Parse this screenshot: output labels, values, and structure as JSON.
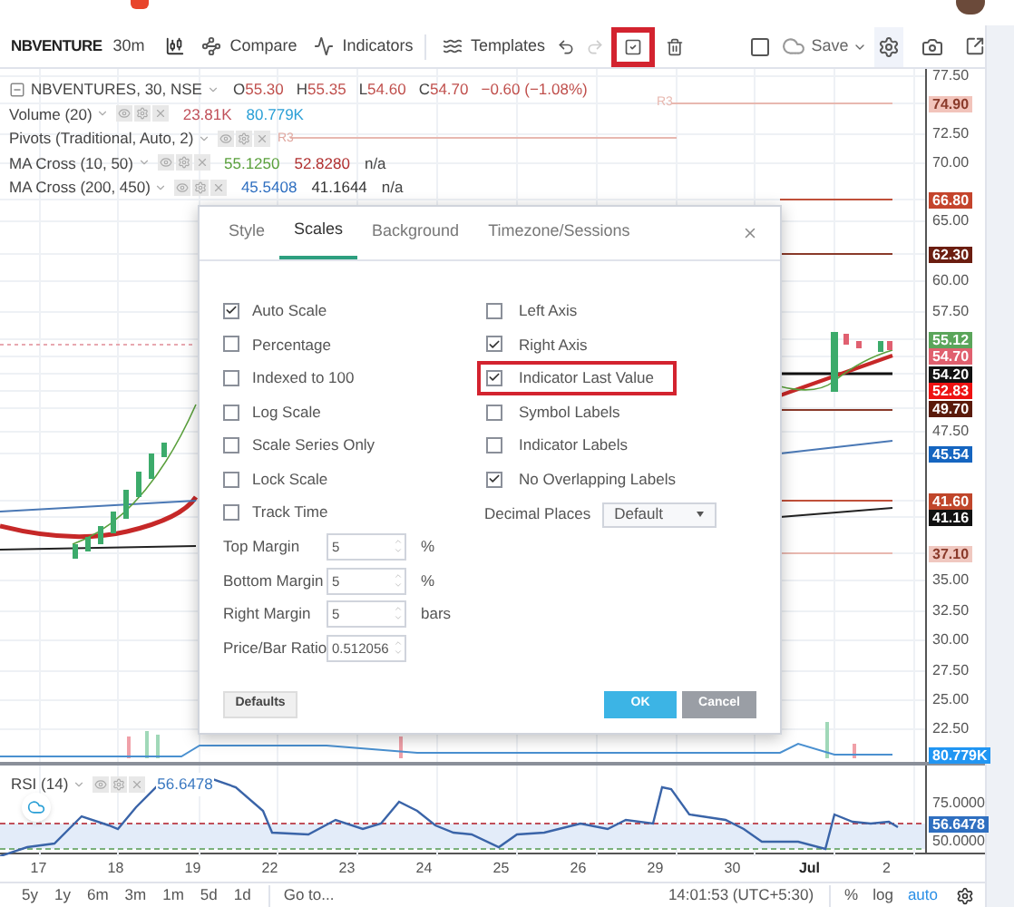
{
  "toolbar": {
    "symbol": "NBVENTURE",
    "interval": "30m",
    "buttons": [
      {
        "kind": "compare",
        "label": "Compare"
      },
      {
        "kind": "indicators",
        "label": "Indicators"
      },
      {
        "kind": "templates",
        "label": "Templates"
      }
    ],
    "tools": [
      {
        "kind": "undo",
        "disabled": false,
        "highlighted": false
      },
      {
        "kind": "redo",
        "disabled": true,
        "highlighted": false
      },
      {
        "kind": "check",
        "disabled": false,
        "highlighted": true
      },
      {
        "kind": "trash",
        "disabled": false,
        "highlighted": false
      }
    ],
    "save": "Save"
  },
  "legend": {
    "symbol": "NBVENTURES, 30, NSE",
    "ohlc": [
      {
        "label": "O",
        "value": "55.30"
      },
      {
        "label": "H",
        "value": "55.35"
      },
      {
        "label": "L",
        "value": "54.60"
      },
      {
        "label": "C",
        "value": "54.70"
      }
    ],
    "change": "−0.60 (−1.08%)",
    "indicators": [
      {
        "name": "Volume (20)",
        "values": [
          {
            "text": "23.81K",
            "color": "#c0505a"
          },
          {
            "text": "80.779K",
            "color": "#2a9fd6"
          }
        ]
      },
      {
        "name": "Pivots (Traditional, Auto, 2)"
      },
      {
        "name": "MA Cross (10, 50)",
        "values": [
          {
            "text": "55.1250",
            "color": "#5aa03c"
          },
          {
            "text": "52.8280",
            "color": "#b03030"
          },
          {
            "text": "n/a",
            "color": "#444444"
          }
        ]
      },
      {
        "name": "MA Cross (200, 450)",
        "values": [
          {
            "text": "45.5408",
            "color": "#2f6fc0"
          },
          {
            "text": "41.1644",
            "color": "#333333"
          },
          {
            "text": "n/a",
            "color": "#444444"
          }
        ]
      }
    ]
  },
  "chart_labels": [
    "R3",
    "R3"
  ],
  "price_axis": [
    {
      "kind": "tick",
      "text": "77.50"
    },
    {
      "kind": "badge",
      "text": "74.90",
      "color": "#f2c4bb"
    },
    {
      "kind": "tick",
      "text": "72.50"
    },
    {
      "kind": "tick",
      "text": "70.00"
    },
    {
      "kind": "badge",
      "text": "66.80",
      "color": "#c4442c"
    },
    {
      "kind": "tick",
      "text": "65.00"
    },
    {
      "kind": "badge",
      "text": "62.30",
      "color": "#6b1d10"
    },
    {
      "kind": "tick",
      "text": "60.00"
    },
    {
      "kind": "tick",
      "text": "57.50"
    },
    {
      "kind": "badge",
      "text": "55.12",
      "color": "#5aa55a"
    },
    {
      "kind": "badge",
      "text": "54.70",
      "color": "#e0606e"
    },
    {
      "kind": "badge",
      "text": "54.20",
      "color": "#111111"
    },
    {
      "kind": "badge",
      "text": "52.83",
      "color": "#ee1111"
    },
    {
      "kind": "badge",
      "text": "49.70",
      "color": "#5a1a0a"
    },
    {
      "kind": "tick",
      "text": "47.50"
    },
    {
      "kind": "badge",
      "text": "45.54",
      "color": "#1565c0"
    },
    {
      "kind": "badge",
      "text": "41.60",
      "color": "#c0462b"
    },
    {
      "kind": "badge",
      "text": "41.16",
      "color": "#111111"
    },
    {
      "kind": "badge",
      "text": "37.10",
      "color": "#f0c8c0"
    },
    {
      "kind": "tick",
      "text": "35.00"
    },
    {
      "kind": "tick",
      "text": "32.50"
    },
    {
      "kind": "tick",
      "text": "30.00"
    },
    {
      "kind": "tick",
      "text": "27.50"
    },
    {
      "kind": "tick",
      "text": "25.00"
    },
    {
      "kind": "tick",
      "text": "22.50"
    },
    {
      "kind": "badge",
      "text": "80.779K",
      "color": "#2196f3"
    }
  ],
  "rsi": {
    "name": "RSI (14)",
    "value": "56.6478",
    "axis": [
      {
        "kind": "tick",
        "text": "75.0000"
      },
      {
        "kind": "badge",
        "text": "56.6478",
        "color": "#2f6fc0"
      },
      {
        "kind": "tick",
        "text": "50.0000"
      }
    ]
  },
  "time_axis": [
    {
      "label": "17",
      "month_start": false
    },
    {
      "label": "18",
      "month_start": false
    },
    {
      "label": "19",
      "month_start": false
    },
    {
      "label": "22",
      "month_start": false
    },
    {
      "label": "23",
      "month_start": false
    },
    {
      "label": "24",
      "month_start": false
    },
    {
      "label": "25",
      "month_start": false
    },
    {
      "label": "26",
      "month_start": false
    },
    {
      "label": "29",
      "month_start": false
    },
    {
      "label": "30",
      "month_start": false
    },
    {
      "label": "Jul",
      "month_start": true
    },
    {
      "label": "2",
      "month_start": false
    }
  ],
  "bottom_bar": {
    "ranges": [
      "5y",
      "1y",
      "6m",
      "3m",
      "1m",
      "5d",
      "1d"
    ],
    "goto": "Go to...",
    "clock": "14:01:53 (UTC+5:30)",
    "scale_modes": [
      {
        "label": "%",
        "selected": false
      },
      {
        "label": "log",
        "selected": false
      },
      {
        "label": "auto",
        "selected": true
      }
    ]
  },
  "dialog": {
    "tabs": [
      {
        "label": "Style",
        "selected": false
      },
      {
        "label": "Scales",
        "selected": true
      },
      {
        "label": "Background",
        "selected": false
      },
      {
        "label": "Timezone/Sessions",
        "selected": false
      }
    ],
    "left_options": [
      {
        "label": "Auto Scale",
        "checked": true
      },
      {
        "label": "Percentage",
        "checked": false
      },
      {
        "label": "Indexed to 100",
        "checked": false
      },
      {
        "label": "Log Scale",
        "checked": false
      },
      {
        "label": "Scale Series Only",
        "checked": false
      },
      {
        "label": "Lock Scale",
        "checked": false
      },
      {
        "label": "Track Time",
        "checked": false
      }
    ],
    "fields": [
      {
        "label": "Top Margin",
        "value": "5",
        "unit": "%"
      },
      {
        "label": "Bottom Margin",
        "value": "5",
        "unit": "%"
      },
      {
        "label": "Right Margin",
        "value": "5",
        "unit": "bars"
      },
      {
        "label": "Price/Bar Ratio",
        "value": "0.512056"
      }
    ],
    "right_options": [
      {
        "label": "Left Axis",
        "checked": false,
        "highlighted": false
      },
      {
        "label": "Right Axis",
        "checked": true,
        "highlighted": false
      },
      {
        "label": "Indicator Last Value",
        "checked": true,
        "highlighted": true
      },
      {
        "label": "Symbol Labels",
        "checked": false,
        "highlighted": false
      },
      {
        "label": "Indicator Labels",
        "checked": false,
        "highlighted": false
      },
      {
        "label": "No Overlapping Labels",
        "checked": true,
        "highlighted": false
      }
    ],
    "decimal_places": {
      "label": "Decimal Places",
      "value": "Default"
    },
    "buttons": [
      {
        "kind": "defaults",
        "label": "Defaults"
      },
      {
        "kind": "ok",
        "label": "OK"
      },
      {
        "kind": "cancel",
        "label": "Cancel"
      }
    ]
  }
}
